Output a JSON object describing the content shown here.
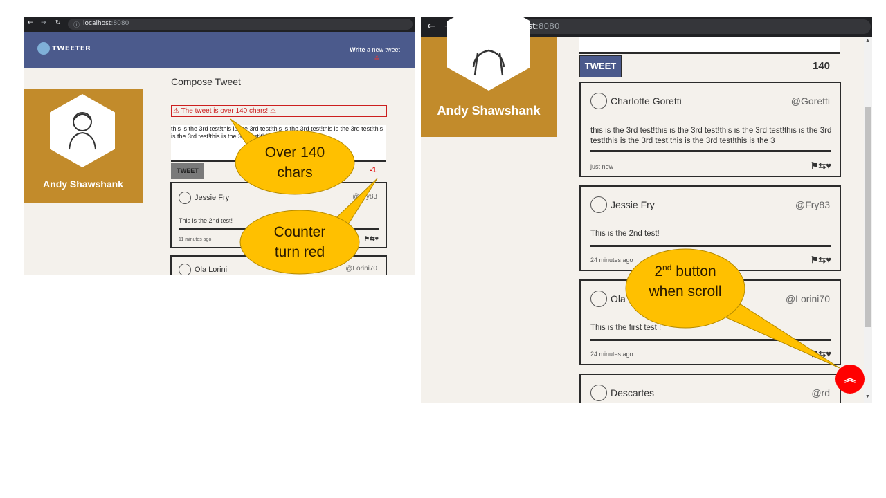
{
  "left": {
    "browser": {
      "url_host": "localhost",
      "url_port": ":8080"
    },
    "header": {
      "logo_text": "TWEETER",
      "write_label_bold": "Write",
      "write_label_rest": " a new tweet"
    },
    "profile": {
      "name": "Andy Shawshank"
    },
    "compose": {
      "title": "Compose Tweet",
      "error_text": "The tweet is over 140 chars!",
      "textarea_value": "this is the 3rd test!this is the 3rd test!this is the 3rd test!this is the 3rd test!this is the 3rd test!this is the 3rd test!this is the 3",
      "tweet_button": "TWEET",
      "counter": "-1"
    },
    "tweets": [
      {
        "name": "Jessie Fry",
        "handle": "@Fry83",
        "text": "This is the 2nd test!",
        "time": "11 minutes ago"
      },
      {
        "name": "Ola Lorini",
        "handle": "@Lorini70"
      }
    ],
    "callouts": {
      "over": "Over 140 chars",
      "counter": "Counter turn red"
    }
  },
  "right": {
    "browser": {
      "url_host": "localhost",
      "url_port": ":8080"
    },
    "profile": {
      "name": "Andy Shawshank"
    },
    "compose": {
      "tweet_button": "TWEET",
      "counter": "140"
    },
    "tweets": [
      {
        "name": "Charlotte Goretti",
        "handle": "@Goretti",
        "text": "this is the 3rd test!this is the 3rd test!this is the 3rd test!this is the 3rd test!this is the 3rd test!this is the 3rd test!this is the 3",
        "time": "just now"
      },
      {
        "name": "Jessie Fry",
        "handle": "@Fry83",
        "text": "This is the 2nd test!",
        "time": "24 minutes ago"
      },
      {
        "name": "Ola L",
        "handle": "@Lorini70",
        "text": "This is the first test !",
        "time": "24 minutes ago"
      },
      {
        "name": "Descartes",
        "handle": "@rd"
      }
    ],
    "callout": {
      "pre": "2",
      "sup": "nd",
      "post": " button when scroll"
    },
    "colors": {
      "scroll_button": "#ff0000",
      "navbar": "#4b5a8c",
      "profile": "#c28b2b",
      "error": "#cc1f1f"
    }
  }
}
